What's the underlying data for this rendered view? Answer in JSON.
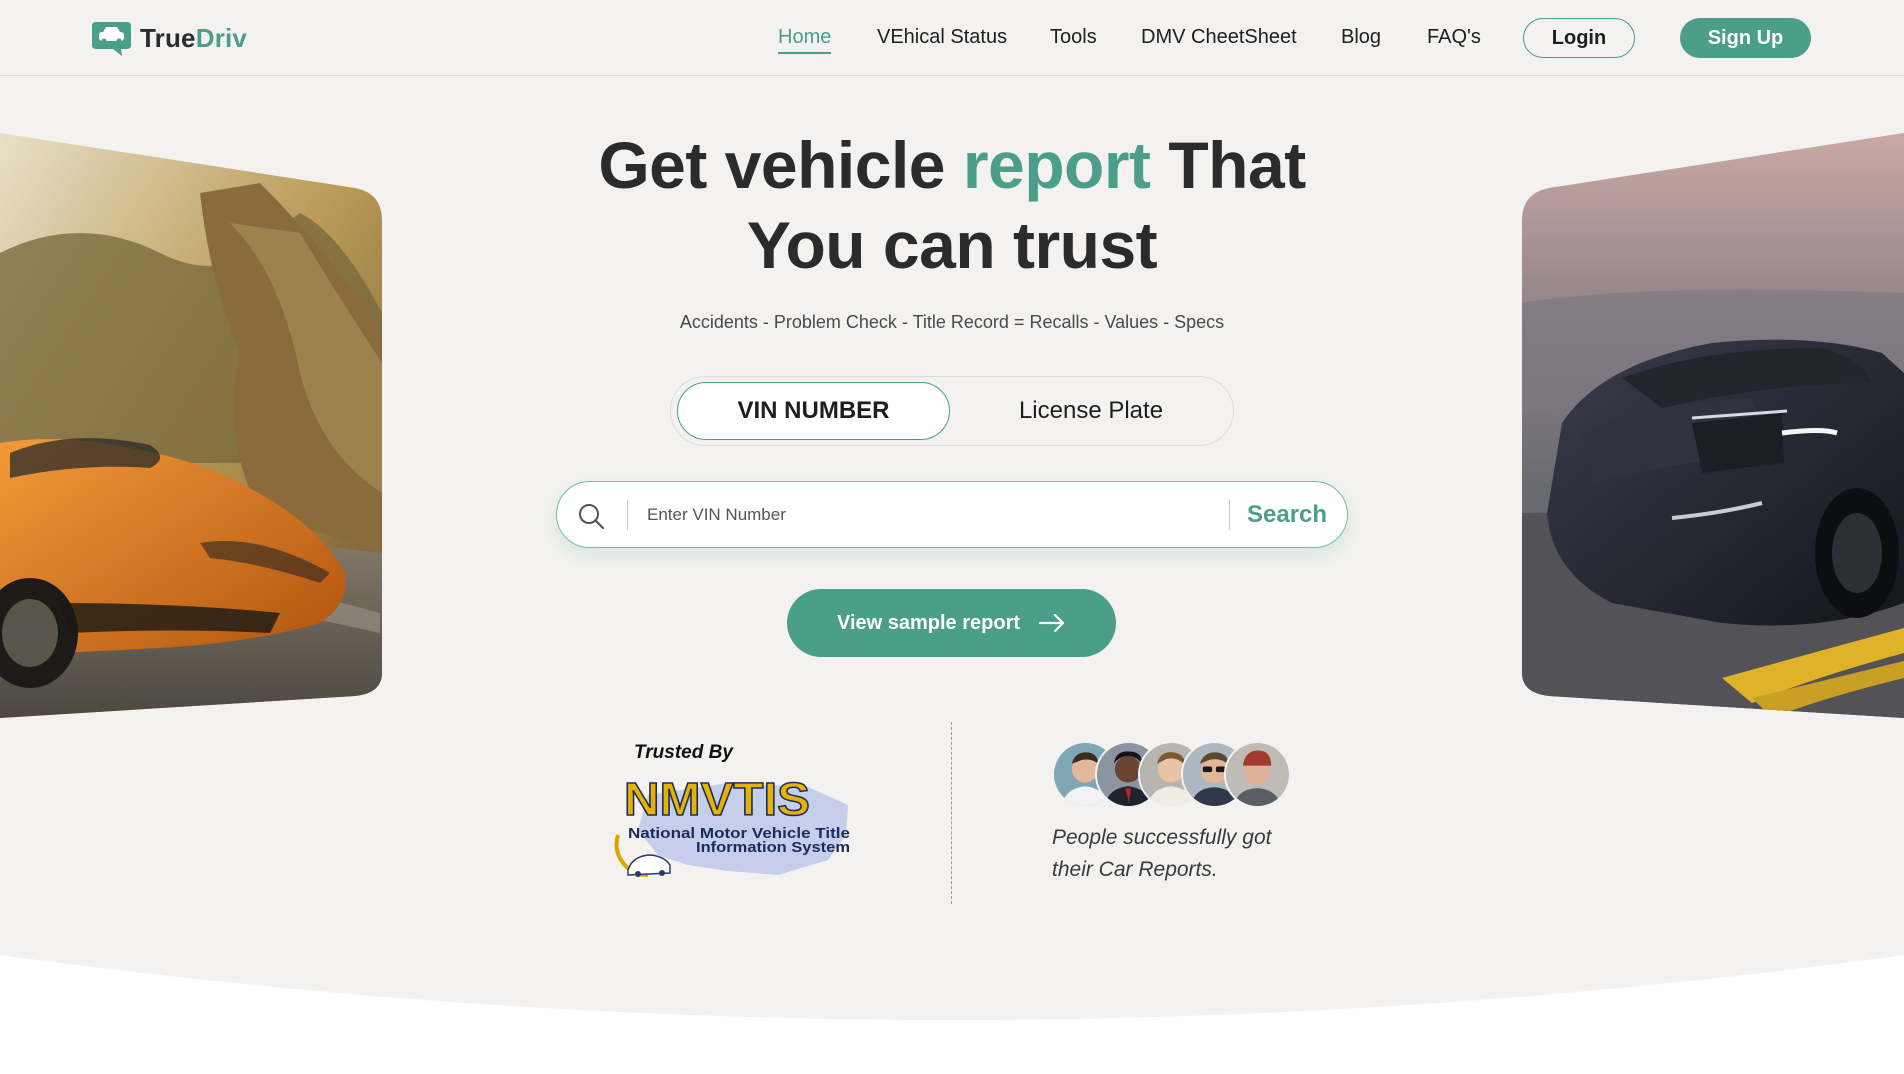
{
  "brand": {
    "name_part1": "True",
    "name_part2": "Driv",
    "accent_color": "#4a9e8a"
  },
  "nav": {
    "items": [
      {
        "label": "Home",
        "active": true
      },
      {
        "label": "VEhical Status",
        "active": false
      },
      {
        "label": "Tools",
        "active": false
      },
      {
        "label": "DMV CheetSheet",
        "active": false
      },
      {
        "label": "Blog",
        "active": false
      },
      {
        "label": "FAQ's",
        "active": false
      }
    ],
    "login_label": "Login",
    "signup_label": "Sign Up"
  },
  "hero": {
    "title_part1": "Get vehicle ",
    "title_accent": "report",
    "title_part2": " That",
    "title_line2": "You can trust",
    "subtitle": "Accidents - Problem Check - Title Record = Recalls - Values - Specs"
  },
  "tabs": [
    {
      "label": "VIN NUMBER",
      "selected": true
    },
    {
      "label": "License Plate",
      "selected": false
    }
  ],
  "search": {
    "placeholder": "Enter VIN Number",
    "value": "",
    "button_label": "Search"
  },
  "sample_report": {
    "label": "View sample report"
  },
  "trusted": {
    "label": "Trusted By",
    "logo_acronym": "NMVTIS",
    "logo_line1": "National Motor Vehicle Title",
    "logo_line2": "Information System"
  },
  "social_proof": {
    "avatar_count": 5,
    "text": "People successfully got their Car Reports."
  },
  "icons": [
    "logo-car-chat-icon",
    "search-icon",
    "arrow-right-icon"
  ]
}
